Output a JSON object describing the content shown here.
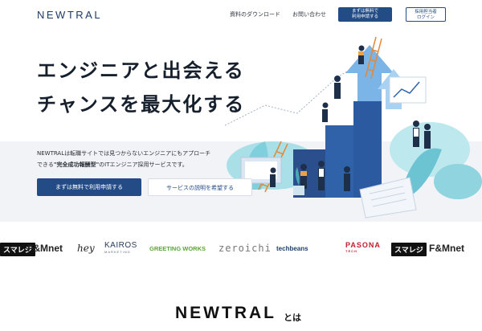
{
  "header": {
    "logo": "NEWTRAL",
    "nav_download": "資料のダウンロード",
    "nav_contact": "お問い合わせ",
    "apply_line1": "まずは無料で",
    "apply_line2": "利用申請する",
    "login_line1": "採用担当者",
    "login_line2": "ログイン"
  },
  "hero": {
    "headline_1": "エンジニアと出会える",
    "headline_2": "チャンスを最大化する",
    "desc_line1": "NEWTRALは転職サイトでは見つからないエンジニアにもアプローチ",
    "desc_line2_prefix": "できる",
    "desc_line2_bold": "\"完全成功報酬型\"",
    "desc_line2_suffix": "のITエンジニア採用サービスです。",
    "apply_button": "まずは無料で利用申請する",
    "explain_button": "サービスの説明を希望する"
  },
  "logos": {
    "smaregi": "スマレジ",
    "fm": "F&Mnet",
    "hey": "hey",
    "kairos": "KAIROS",
    "kairos_sub": "MARKETING",
    "greeting": "GREETING WORKS",
    "zero": "zeroichi",
    "techbeans": "techbeans",
    "pasona": "PASONA",
    "pasona_sub": "TECH"
  },
  "about": {
    "heading": "NEWTRAL",
    "suffix": "とは"
  },
  "colors": {
    "brand_navy": "#234b86",
    "illustration_blue": "#2f62a8",
    "illustration_teal": "#7fd0dc",
    "greeting_green": "#5da33a",
    "pasona_red": "#c01d2e"
  }
}
